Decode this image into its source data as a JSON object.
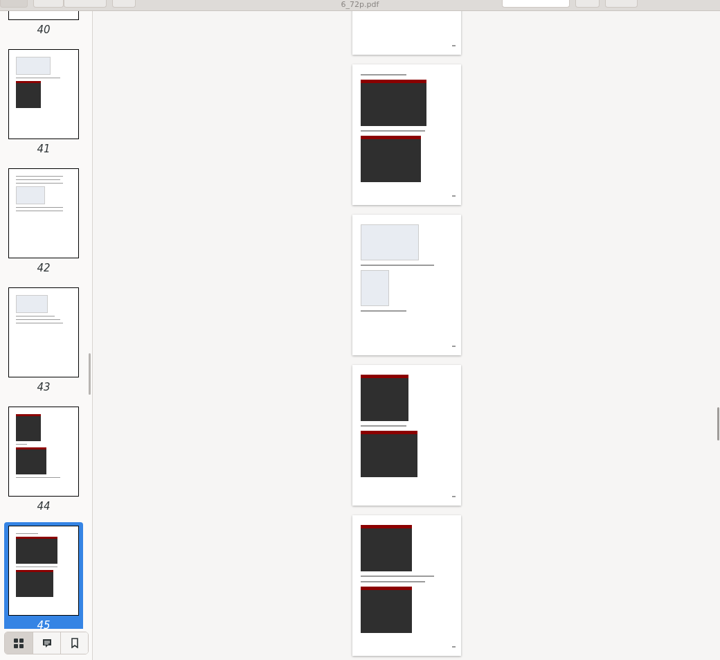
{
  "window": {
    "title": "6_72p.pdf"
  },
  "sidebar": {
    "thumbnails": [
      {
        "page": "40",
        "selected": false
      },
      {
        "page": "41",
        "selected": false
      },
      {
        "page": "42",
        "selected": false
      },
      {
        "page": "43",
        "selected": false
      },
      {
        "page": "44",
        "selected": false
      },
      {
        "page": "45",
        "selected": true
      }
    ],
    "view_buttons": [
      {
        "kind": "thumbnails",
        "selected": true
      },
      {
        "kind": "annotations",
        "selected": false
      },
      {
        "kind": "bookmarks",
        "selected": false
      }
    ]
  }
}
